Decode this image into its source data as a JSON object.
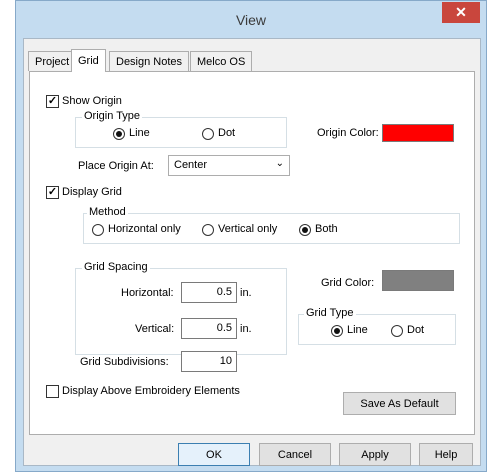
{
  "window": {
    "title": "View",
    "close_glyph": "✕"
  },
  "tabs": [
    {
      "label": "Project"
    },
    {
      "label": "Grid"
    },
    {
      "label": "Design Notes"
    },
    {
      "label": "Melco OS"
    }
  ],
  "origin": {
    "show_label": "Show Origin",
    "show_checked": true,
    "type_group_label": "Origin Type",
    "line_label": "Line",
    "dot_label": "Dot",
    "selected_type": "Line",
    "color_label": "Origin Color:",
    "color": "#ff0000",
    "place_label": "Place Origin At:",
    "place_value": "Center"
  },
  "grid": {
    "display_label": "Display Grid",
    "display_checked": true,
    "method_group_label": "Method",
    "horizontal_only_label": "Horizontal only",
    "vertical_only_label": "Vertical only",
    "both_label": "Both",
    "selected_method": "Both",
    "spacing_group_label": "Grid Spacing",
    "horizontal_label": "Horizontal:",
    "horizontal_value": "0.5",
    "vertical_label": "Vertical:",
    "vertical_value": "0.5",
    "unit": "in.",
    "color_label": "Grid Color:",
    "color": "#808080",
    "type_group_label": "Grid Type",
    "line_label": "Line",
    "dot_label": "Dot",
    "selected_type": "Line",
    "subdivisions_label": "Grid Subdivisions:",
    "subdivisions_value": "10"
  },
  "display_above": {
    "label": "Display Above Embroidery Elements",
    "checked": false
  },
  "buttons": {
    "save_default": "Save As Default",
    "ok": "OK",
    "cancel": "Cancel",
    "apply": "Apply",
    "help": "Help"
  },
  "icons": {
    "dropdown": "chevron-down-icon",
    "check": "✓"
  }
}
